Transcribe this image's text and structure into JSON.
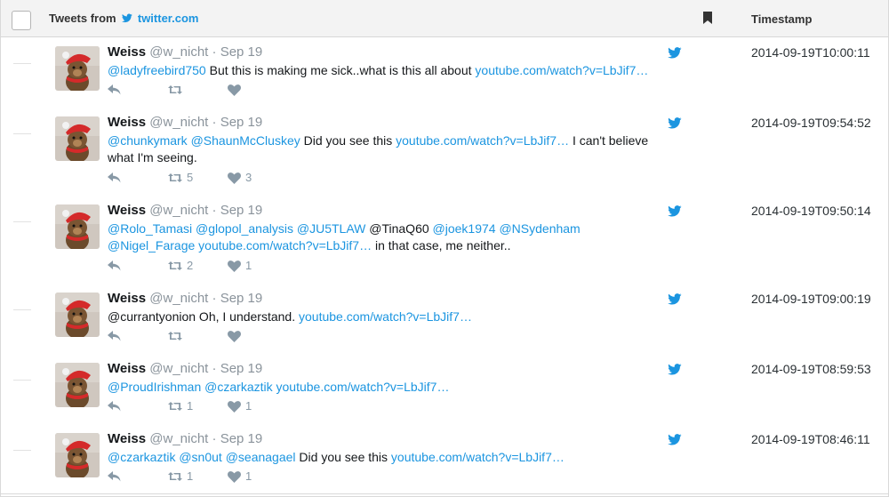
{
  "header": {
    "title_prefix": "Tweets from",
    "source_link": "twitter.com",
    "timestamp_label": "Timestamp"
  },
  "colors": {
    "accent": "#1b95e0",
    "header_bg": "#f3f3f3",
    "muted": "#8899a6"
  },
  "icons": {
    "bird": "twitter-bird-icon",
    "bookmark": "bookmark-icon",
    "reply": "reply-icon",
    "retweet": "retweet-icon",
    "like": "heart-icon"
  },
  "tweets": [
    {
      "author": "Weiss",
      "handle": "@w_nicht",
      "date": "Sep 19",
      "segments": [
        {
          "t": "mention",
          "v": "@ladyfreebird750"
        },
        {
          "t": "text",
          "v": " But this is making me sick..what is this all about "
        },
        {
          "t": "link",
          "v": "youtube.com/watch?v=LbJif7…"
        }
      ],
      "retweets": "",
      "likes": "",
      "timestamp": "2014-09-19T10:00:11"
    },
    {
      "author": "Weiss",
      "handle": "@w_nicht",
      "date": "Sep 19",
      "segments": [
        {
          "t": "mention",
          "v": "@chunkymark"
        },
        {
          "t": "text",
          "v": " "
        },
        {
          "t": "mention",
          "v": "@ShaunMcCluskey"
        },
        {
          "t": "text",
          "v": " Did you see this "
        },
        {
          "t": "link",
          "v": "youtube.com/watch?v=LbJif7…"
        },
        {
          "t": "text",
          "v": " I can't believe what I'm seeing."
        }
      ],
      "retweets": "5",
      "likes": "3",
      "timestamp": "2014-09-19T09:54:52"
    },
    {
      "author": "Weiss",
      "handle": "@w_nicht",
      "date": "Sep 19",
      "segments": [
        {
          "t": "mention",
          "v": "@Rolo_Tamasi"
        },
        {
          "t": "text",
          "v": " "
        },
        {
          "t": "mention",
          "v": "@glopol_analysis"
        },
        {
          "t": "text",
          "v": " "
        },
        {
          "t": "mention",
          "v": "@JU5TLAW"
        },
        {
          "t": "text",
          "v": " @TinaQ60 "
        },
        {
          "t": "mention",
          "v": "@joek1974"
        },
        {
          "t": "text",
          "v": " "
        },
        {
          "t": "mention",
          "v": "@NSydenham"
        },
        {
          "t": "text",
          "v": " "
        },
        {
          "t": "mention",
          "v": "@Nigel_Farage"
        },
        {
          "t": "text",
          "v": " "
        },
        {
          "t": "link",
          "v": "youtube.com/watch?v=LbJif7…"
        },
        {
          "t": "text",
          "v": " in that case, me neither.."
        }
      ],
      "retweets": "2",
      "likes": "1",
      "timestamp": "2014-09-19T09:50:14"
    },
    {
      "author": "Weiss",
      "handle": "@w_nicht",
      "date": "Sep 19",
      "segments": [
        {
          "t": "text",
          "v": "@currantyonion Oh, I understand. "
        },
        {
          "t": "link",
          "v": "youtube.com/watch?v=LbJif7…"
        }
      ],
      "retweets": "",
      "likes": "",
      "timestamp": "2014-09-19T09:00:19"
    },
    {
      "author": "Weiss",
      "handle": "@w_nicht",
      "date": "Sep 19",
      "segments": [
        {
          "t": "mention",
          "v": "@ProudIrishman"
        },
        {
          "t": "text",
          "v": " "
        },
        {
          "t": "mention",
          "v": "@czarkaztik"
        },
        {
          "t": "text",
          "v": " "
        },
        {
          "t": "link",
          "v": "youtube.com/watch?v=LbJif7…"
        }
      ],
      "retweets": "1",
      "likes": "1",
      "timestamp": "2014-09-19T08:59:53"
    },
    {
      "author": "Weiss",
      "handle": "@w_nicht",
      "date": "Sep 19",
      "segments": [
        {
          "t": "mention",
          "v": "@czarkaztik"
        },
        {
          "t": "text",
          "v": " "
        },
        {
          "t": "mention",
          "v": "@sn0ut"
        },
        {
          "t": "text",
          "v": " "
        },
        {
          "t": "mention",
          "v": "@seanagael"
        },
        {
          "t": "text",
          "v": " Did you see this "
        },
        {
          "t": "link",
          "v": "youtube.com/watch?v=LbJif7…"
        }
      ],
      "retweets": "1",
      "likes": "1",
      "timestamp": "2014-09-19T08:46:11"
    }
  ]
}
